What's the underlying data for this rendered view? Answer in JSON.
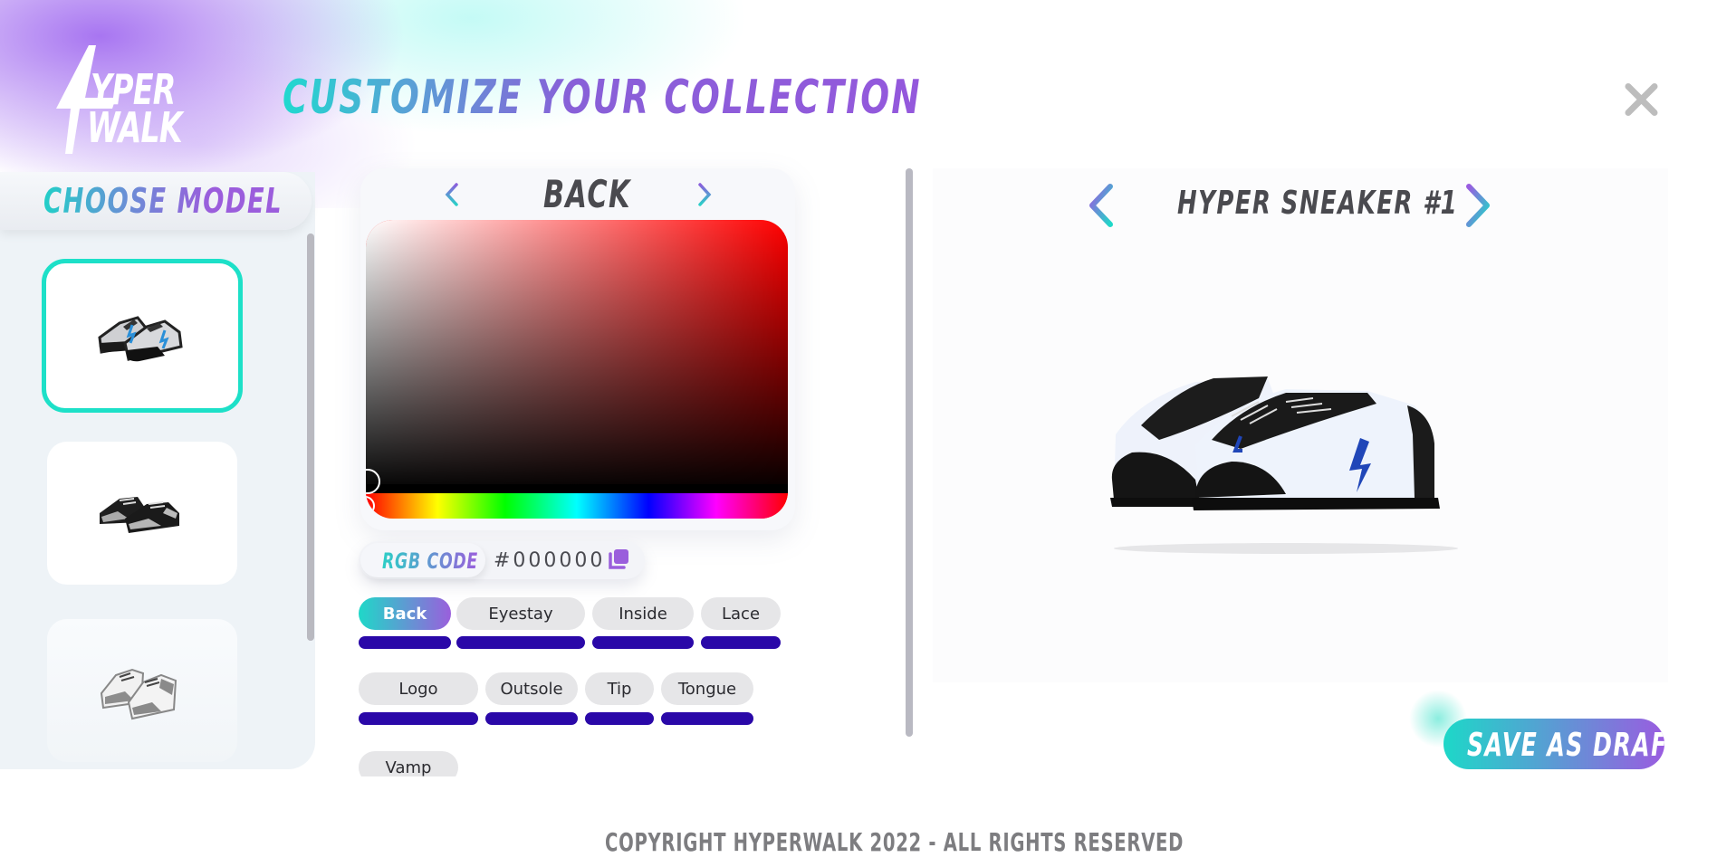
{
  "brand": {
    "logo_line1": "YPER",
    "logo_line2": "WALK",
    "colors": {
      "accent_teal": "#1dd8c8",
      "accent_purple": "#9a5ce0",
      "part_swatch": "#2a08a8",
      "selected_border": "#1de0c8"
    }
  },
  "header": {
    "title": "CUSTOMIZE YOUR COLLECTION",
    "close_icon": "close-icon"
  },
  "model_panel": {
    "title": "CHOOSE MODEL",
    "models": [
      {
        "name": "Hyper Sneaker #1 thumbnail",
        "selected": true
      },
      {
        "name": "Hyper Sneaker #2 thumbnail",
        "selected": false
      },
      {
        "name": "Hyper Sneaker #3 thumbnail",
        "selected": false
      }
    ]
  },
  "color_editor": {
    "current_part": "BACK",
    "prev_icon": "chevron-left-icon",
    "next_icon": "chevron-right-icon",
    "hue_color": "#ff0000",
    "rgb_label": "RGB CODE",
    "rgb_value": "#000000",
    "copy_icon": "copy-icon",
    "parts": [
      {
        "label": "Back",
        "active": true,
        "color": "#2a08a8"
      },
      {
        "label": "Eyestay",
        "active": false,
        "color": "#2a08a8"
      },
      {
        "label": "Inside",
        "active": false,
        "color": "#2a08a8"
      },
      {
        "label": "Lace",
        "active": false,
        "color": "#2a08a8"
      },
      {
        "label": "Logo",
        "active": false,
        "color": "#2a08a8"
      },
      {
        "label": "Outsole",
        "active": false,
        "color": "#2a08a8"
      },
      {
        "label": "Tip",
        "active": false,
        "color": "#2a08a8"
      },
      {
        "label": "Tongue",
        "active": false,
        "color": "#2a08a8"
      },
      {
        "label": "Vamp",
        "active": false,
        "color": "#2a08a8"
      }
    ]
  },
  "preview": {
    "model_name": "HYPER SNEAKER #1",
    "prev_icon": "chevron-left-icon",
    "next_icon": "chevron-right-icon"
  },
  "actions": {
    "save_draft": "SAVE AS DRAFT"
  },
  "footer": {
    "copyright": "COPYRIGHT HYPERWALK 2022 - ALL RIGHTS RESERVED"
  }
}
